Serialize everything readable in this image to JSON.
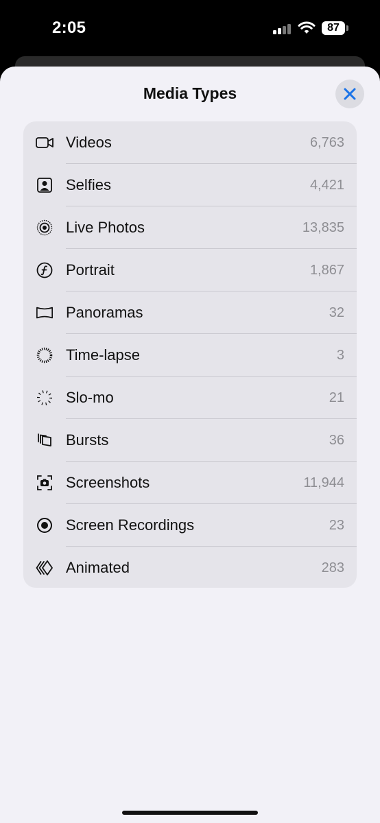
{
  "status_bar": {
    "time": "2:05",
    "battery": "87"
  },
  "sheet": {
    "title": "Media Types",
    "close_icon": "xmark-icon"
  },
  "media_types": [
    {
      "label": "Videos",
      "count": "6,763",
      "icon": "video-camera-icon"
    },
    {
      "label": "Selfies",
      "count": "4,421",
      "icon": "selfie-portrait-icon"
    },
    {
      "label": "Live Photos",
      "count": "13,835",
      "icon": "live-photo-icon"
    },
    {
      "label": "Portrait",
      "count": "1,867",
      "icon": "portrait-aperture-icon"
    },
    {
      "label": "Panoramas",
      "count": "32",
      "icon": "panorama-icon"
    },
    {
      "label": "Time-lapse",
      "count": "3",
      "icon": "timelapse-icon"
    },
    {
      "label": "Slo-mo",
      "count": "21",
      "icon": "slomo-icon"
    },
    {
      "label": "Bursts",
      "count": "36",
      "icon": "bursts-icon"
    },
    {
      "label": "Screenshots",
      "count": "11,944",
      "icon": "screenshot-icon"
    },
    {
      "label": "Screen Recordings",
      "count": "23",
      "icon": "screen-recording-icon"
    },
    {
      "label": "Animated",
      "count": "283",
      "icon": "animated-icon"
    }
  ],
  "colors": {
    "accent": "#1a73e8",
    "sheet_bg": "#f2f1f7",
    "card_bg": "#e5e4ea",
    "count_text": "#8e8e93"
  }
}
